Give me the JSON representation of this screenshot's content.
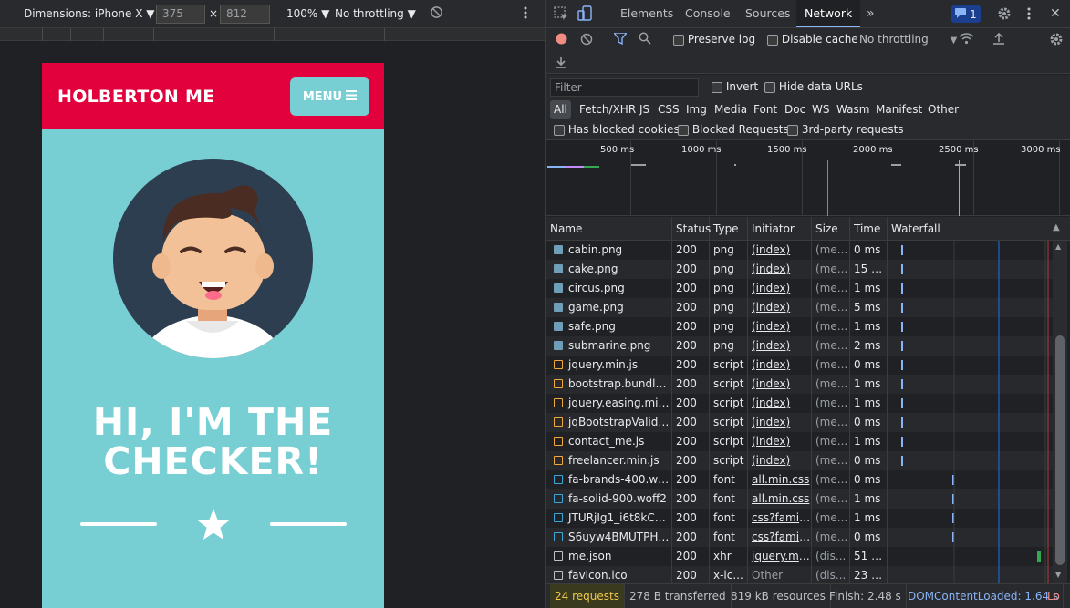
{
  "device_toolbar": {
    "dimensions_label": "Dimensions: iPhone X",
    "width_value": "375",
    "height_value": "812",
    "times": "×",
    "zoom": "100%",
    "throttling": "No throttling"
  },
  "site": {
    "brand": "HOLBERTON ME",
    "menu_label": "MENU",
    "hero_line1": "HI, I'M THE",
    "hero_line2": "CHECKER!",
    "header_color": "#e2003d",
    "accent_color": "#78cfd3"
  },
  "devtools": {
    "tabs": [
      "Elements",
      "Console",
      "Sources",
      "Network"
    ],
    "active_tab": "Network",
    "more_tabs": "»",
    "issues_count": "1",
    "toolbar": {
      "preserve_log": "Preserve log",
      "disable_cache": "Disable cache",
      "throttling": "No throttling"
    },
    "filter": {
      "placeholder": "Filter",
      "invert": "Invert",
      "hide_data_urls": "Hide data URLs",
      "types": [
        "All",
        "Fetch/XHR",
        "JS",
        "CSS",
        "Img",
        "Media",
        "Font",
        "Doc",
        "WS",
        "Wasm",
        "Manifest",
        "Other"
      ],
      "has_blocked_cookies": "Has blocked cookies",
      "blocked_requests": "Blocked Requests",
      "third_party": "3rd-party requests"
    },
    "overview": {
      "ticks": [
        "500 ms",
        "1000 ms",
        "1500 ms",
        "2000 ms",
        "2500 ms",
        "3000 ms"
      ]
    },
    "columns": {
      "name": "Name",
      "status": "Status",
      "type": "Type",
      "initiator": "Initiator",
      "size": "Size",
      "time": "Time",
      "waterfall": "Waterfall"
    },
    "requests": [
      {
        "name": "cabin.png",
        "status": "200",
        "type": "png",
        "initiator": "(index)",
        "size": "(me...",
        "time": "0 ms",
        "icon": "image-icon",
        "wf": 0.08
      },
      {
        "name": "cake.png",
        "status": "200",
        "type": "png",
        "initiator": "(index)",
        "size": "(me...",
        "time": "15 ms",
        "icon": "image-icon",
        "wf": 0.085
      },
      {
        "name": "circus.png",
        "status": "200",
        "type": "png",
        "initiator": "(index)",
        "size": "(me...",
        "time": "1 ms",
        "icon": "image-icon",
        "wf": 0.085
      },
      {
        "name": "game.png",
        "status": "200",
        "type": "png",
        "initiator": "(index)",
        "size": "(me...",
        "time": "5 ms",
        "icon": "image-icon",
        "wf": 0.085
      },
      {
        "name": "safe.png",
        "status": "200",
        "type": "png",
        "initiator": "(index)",
        "size": "(me...",
        "time": "1 ms",
        "icon": "image-icon",
        "wf": 0.085
      },
      {
        "name": "submarine.png",
        "status": "200",
        "type": "png",
        "initiator": "(index)",
        "size": "(me...",
        "time": "2 ms",
        "icon": "image-icon",
        "wf": 0.085
      },
      {
        "name": "jquery.min.js",
        "status": "200",
        "type": "script",
        "initiator": "(index)",
        "size": "(me...",
        "time": "0 ms",
        "icon": "script-icon",
        "wf": 0.085
      },
      {
        "name": "bootstrap.bundle....",
        "status": "200",
        "type": "script",
        "initiator": "(index)",
        "size": "(me...",
        "time": "1 ms",
        "icon": "script-icon",
        "wf": 0.085
      },
      {
        "name": "jquery.easing.min.js",
        "status": "200",
        "type": "script",
        "initiator": "(index)",
        "size": "(me...",
        "time": "1 ms",
        "icon": "script-icon",
        "wf": 0.085
      },
      {
        "name": "jqBootstrapValidat...",
        "status": "200",
        "type": "script",
        "initiator": "(index)",
        "size": "(me...",
        "time": "0 ms",
        "icon": "script-icon",
        "wf": 0.085
      },
      {
        "name": "contact_me.js",
        "status": "200",
        "type": "script",
        "initiator": "(index)",
        "size": "(me...",
        "time": "1 ms",
        "icon": "script-icon",
        "wf": 0.085
      },
      {
        "name": "freelancer.min.js",
        "status": "200",
        "type": "script",
        "initiator": "(index)",
        "size": "(me...",
        "time": "0 ms",
        "icon": "script-icon",
        "wf": 0.085
      },
      {
        "name": "fa-brands-400.woff2",
        "status": "200",
        "type": "font",
        "initiator": "all.min.css",
        "size": "(me...",
        "time": "0 ms",
        "icon": "font-icon",
        "wf": 0.39
      },
      {
        "name": "fa-solid-900.woff2",
        "status": "200",
        "type": "font",
        "initiator": "all.min.css",
        "size": "(me...",
        "time": "1 ms",
        "icon": "font-icon",
        "wf": 0.39
      },
      {
        "name": "JTURjIg1_i6t8kCH...",
        "status": "200",
        "type": "font",
        "initiator": "css?famil...",
        "size": "(me...",
        "time": "1 ms",
        "icon": "font-icon",
        "wf": 0.39
      },
      {
        "name": "S6uyw4BMUTPHjx...",
        "status": "200",
        "type": "font",
        "initiator": "css?famil...",
        "size": "(me...",
        "time": "0 ms",
        "icon": "font-icon",
        "wf": 0.39
      },
      {
        "name": "me.json",
        "status": "200",
        "type": "xhr",
        "initiator": "jquery.mi...",
        "size": "(dis...",
        "time": "51 ms",
        "icon": "document-icon",
        "wf": 0.9
      },
      {
        "name": "favicon.ico",
        "status": "200",
        "type": "x-ic...",
        "initiator": "Other",
        "size": "(dis...",
        "time": "23 ms",
        "icon": "document-icon",
        "wf": -1
      }
    ],
    "status": {
      "requests": "24 requests",
      "transferred": "278 B transferred",
      "resources": "819 kB resources",
      "finish": "Finish: 2.48 s",
      "dcl": "DOMContentLoaded: 1.64 s",
      "load": "Lo"
    }
  }
}
